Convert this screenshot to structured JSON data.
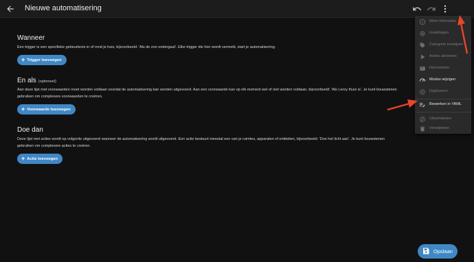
{
  "header": {
    "title": "Nieuwe automatisering",
    "icons": [
      "back-arrow-icon",
      "undo-icon",
      "redo-icon",
      "more-vertical-icon"
    ]
  },
  "sections": [
    {
      "title": "Wanneer",
      "subtitle": "",
      "description": "Een trigger is een specifieke gebeurtenis in of rond je huis, bijvoorbeeld: 'Als de zon ondergaat'. Elke trigger die hier wordt vermeld, start je automatisering.",
      "button": "Trigger toevoegen"
    },
    {
      "title": "En als",
      "subtitle": "(optioneel)",
      "description": "Aan deze lijst met voorwaarden moet worden voldaan voordat de automatisering kan worden uitgevoerd. Aan een voorwaarde kan op elk moment wel of niet worden voldaan, bijvoorbeeld: 'Als Leroy thuis is'. Je kunt bouwstenen gebruiken om complexere voorwaarden te creëren.",
      "button": "Voorwaarde toevoegen"
    },
    {
      "title": "Doe dan",
      "subtitle": "",
      "description": "Deze lijst met acties wordt op volgorde uitgevoerd wanneer de automatisering wordt uitgevoerd. Een actie bestuurt meestal een van je ruimtes, apparaten of entiteiten, bijvoorbeeld: 'Doe het licht aan'. Je kunt bouwstenen gebruiken om complexere acties te creëren.",
      "button": "Actie toevoegen"
    }
  ],
  "menu": {
    "items": [
      {
        "label": "Meer informatie",
        "icon": "info-icon",
        "enabled": false
      },
      {
        "label": "Instellingen",
        "icon": "gear-icon",
        "enabled": false
      },
      {
        "label": "Categorie toewijzen",
        "icon": "tag-icon",
        "enabled": false
      },
      {
        "label": "Acties uitvoeren",
        "icon": "play-icon",
        "enabled": false
      },
      {
        "label": "Hernoemen",
        "icon": "rename-icon",
        "enabled": false
      },
      {
        "label": "Modus wijzigen",
        "icon": "speedometer-icon",
        "enabled": true
      },
      {
        "label": "Dupliceren",
        "icon": "duplicate-icon",
        "enabled": false
      },
      {
        "label": "Bewerken in YAML",
        "icon": "edit-list-icon",
        "enabled": true
      },
      {
        "label": "Uitschakelen",
        "icon": "disable-icon",
        "enabled": false
      },
      {
        "label": "Verwijderen",
        "icon": "trash-icon",
        "enabled": false
      }
    ]
  },
  "fab": {
    "label": "Opslaan",
    "icon": "save-icon"
  },
  "colors": {
    "background": "#111111",
    "topbar": "#1c1c1c",
    "accent": "#3f88c5",
    "menu_bg": "#2a2a2a",
    "annotation_arrow": "#e8452c"
  }
}
